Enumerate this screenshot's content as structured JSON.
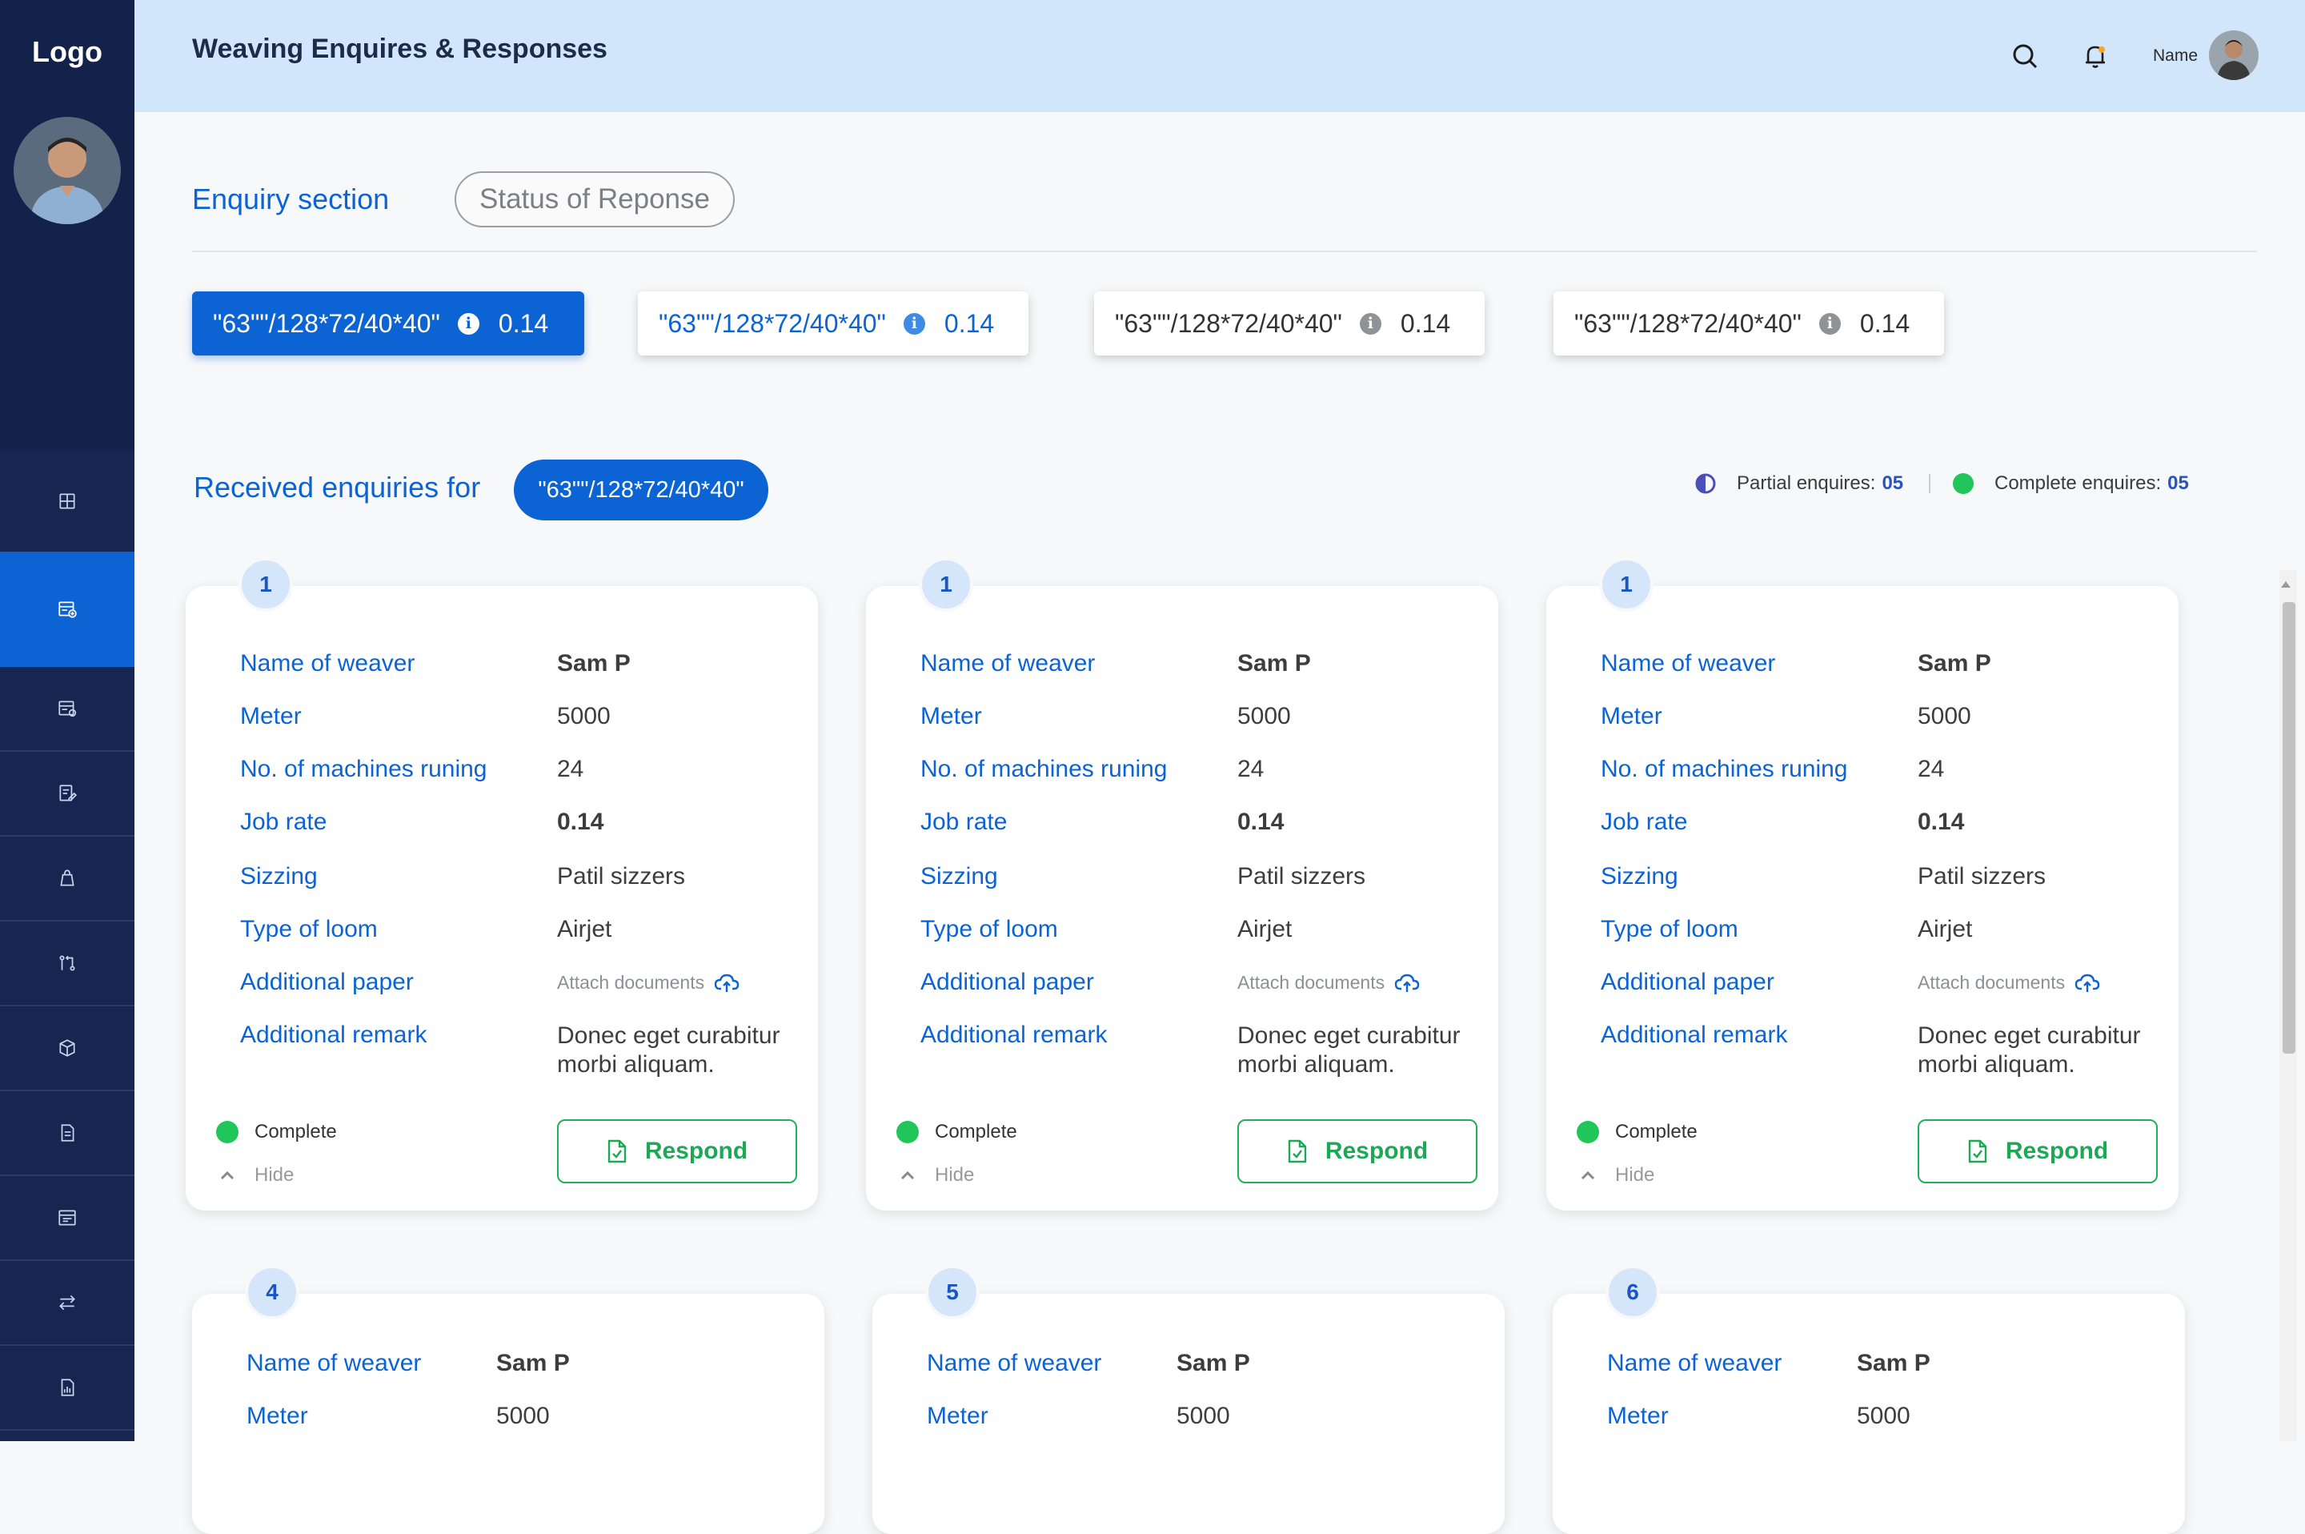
{
  "sidebar": {
    "logo": "Logo",
    "nav_icons": [
      "dashboard-icon",
      "enquiry-icon",
      "orders-icon",
      "edit-icon",
      "bag-icon",
      "transfer-icon",
      "package-icon",
      "document-icon",
      "invoice-icon",
      "exchange-icon",
      "report-icon"
    ],
    "active_index": 1
  },
  "header": {
    "title": "Weaving Enquires & Responses",
    "user_name": "Name"
  },
  "tabs": {
    "active": "Enquiry section",
    "inactive": "Status of Reponse"
  },
  "qualities": [
    {
      "label": "\"63\"\"/128*72/40*40\"",
      "rate": "0.14",
      "state": "active"
    },
    {
      "label": "\"63\"\"/128*72/40*40\"",
      "rate": "0.14",
      "state": "blue"
    },
    {
      "label": "\"63\"\"/128*72/40*40\"",
      "rate": "0.14",
      "state": "plain"
    },
    {
      "label": "\"63\"\"/128*72/40*40\"",
      "rate": "0.14",
      "state": "plain"
    }
  ],
  "received": {
    "label": "Received enquiries for",
    "quality": "\"63\"\"/128*72/40*40\"",
    "partial_label": "Partial enquires:",
    "partial_count": "05",
    "complete_label": "Complete enquires:",
    "complete_count": "05",
    "partial_color": "#4b4fb8",
    "complete_color": "#20c65a"
  },
  "field_labels": {
    "weaver": "Name of weaver",
    "meter": "Meter",
    "machines": "No. of machines runing",
    "job_rate": "Job rate",
    "sizing": "Sizzing",
    "loom": "Type of loom",
    "paper": "Additional paper",
    "remark": "Additional remark"
  },
  "cards": [
    {
      "number": "1",
      "weaver": "Sam P",
      "meter": "5000",
      "machines": "24",
      "job_rate": "0.14",
      "sizing": "Patil sizzers",
      "loom": "Airjet",
      "paper": "Attach documents",
      "remark": "Donec eget curabitur morbi aliquam.",
      "status": "Complete",
      "toggle": "Hide",
      "action": "Respond"
    },
    {
      "number": "1",
      "weaver": "Sam P",
      "meter": "5000",
      "machines": "24",
      "job_rate": "0.14",
      "sizing": "Patil sizzers",
      "loom": "Airjet",
      "paper": "Attach documents",
      "remark": "Donec eget curabitur morbi aliquam.",
      "status": "Complete",
      "toggle": "Hide",
      "action": "Respond"
    },
    {
      "number": "1",
      "weaver": "Sam P",
      "meter": "5000",
      "machines": "24",
      "job_rate": "0.14",
      "sizing": "Patil sizzers",
      "loom": "Airjet",
      "paper": "Attach documents",
      "remark": "Donec eget curabitur morbi aliquam.",
      "status": "Complete",
      "toggle": "Hide",
      "action": "Respond"
    },
    {
      "number": "4",
      "weaver": "Sam P",
      "meter": "5000"
    },
    {
      "number": "5",
      "weaver": "Sam P",
      "meter": "5000"
    },
    {
      "number": "6",
      "weaver": "Sam P",
      "meter": "5000"
    }
  ]
}
